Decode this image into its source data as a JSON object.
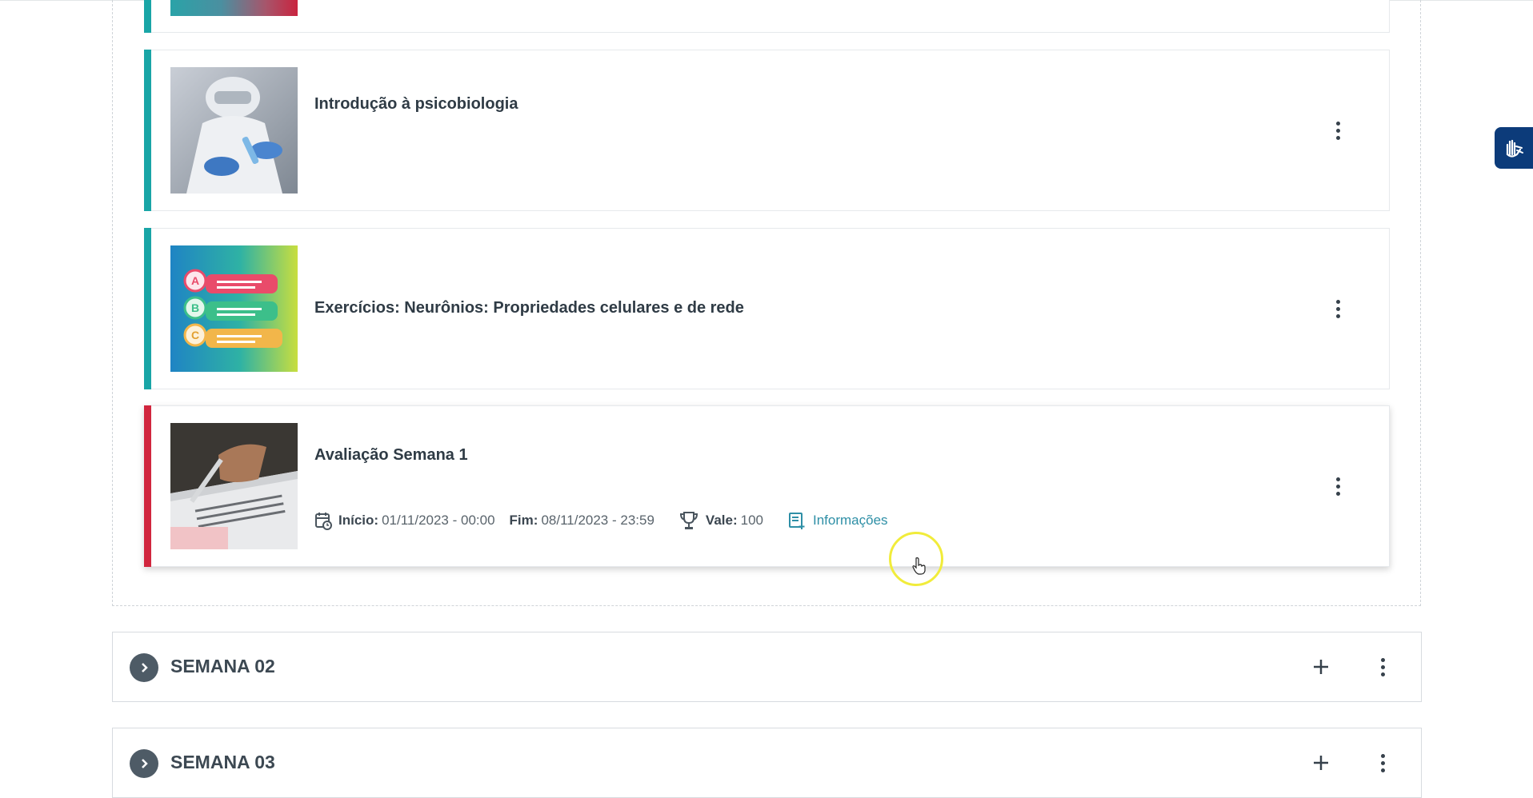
{
  "activities": [
    {
      "title": "Introdução à psicobiologia",
      "status_color": "#19a5a6",
      "thumbnail_icon": "lab-scientist-image"
    },
    {
      "title": "Exercícios: Neurônios: Propriedades celulares e de rede",
      "status_color": "#19a5a6",
      "thumbnail_icon": "quiz-abc-image"
    },
    {
      "title": "Avaliação Semana 1",
      "status_color": "#d1263e",
      "thumbnail_icon": "exam-answer-sheet-image",
      "start_label": "Início:",
      "start_value": "01/11/2023 - 00:00",
      "end_label": "Fim:",
      "end_value": "08/11/2023 - 23:59",
      "value_label": "Vale:",
      "value_value": "100",
      "info_link": "Informações",
      "quiz_letters": [
        "A",
        "B",
        "C"
      ]
    }
  ],
  "weeks": [
    {
      "title": "SEMANA 02"
    },
    {
      "title": "SEMANA 03"
    }
  ],
  "colors": {
    "teal": "#19a5a6",
    "red": "#d1263e",
    "link": "#2e8fa6",
    "a11y": "#0c3b7a"
  }
}
